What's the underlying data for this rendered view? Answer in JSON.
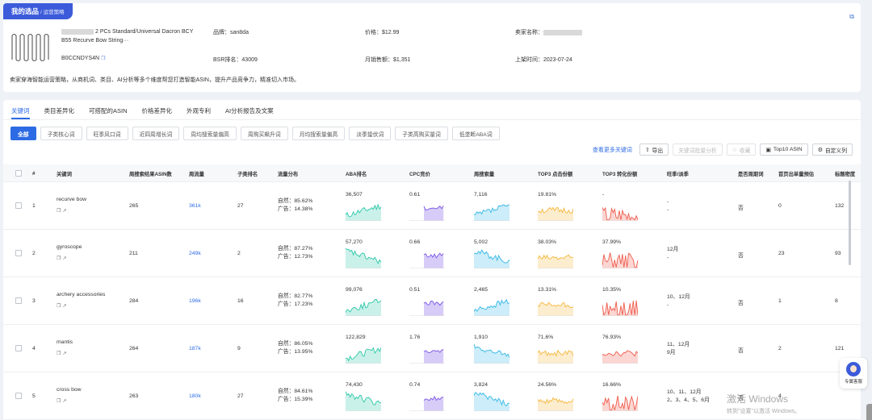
{
  "header": {
    "badge_main": "我的选品",
    "badge_sub": "/ 运营策略"
  },
  "product": {
    "name": "2 PCs Standard/Universal Dacron BCY B55 Recurve Bow String···",
    "asin": "B0CCNDYS4N",
    "brand_label": "品牌：",
    "brand": "san8da",
    "price_label": "价格：",
    "price": "$12.99",
    "seller_label": "卖家名称：",
    "bsr_label": "BSR排名：",
    "bsr": "43009",
    "sales_label": "月销售额：",
    "sales": "$1,351",
    "date_label": "上架时间：",
    "date": "2023-07-24",
    "description": "卖家穿海智能运营策略，从商机词、类目、AI分析等多个维度帮您打造智能ASIN，提升产品竞争力，精准切入市场。"
  },
  "tabs": [
    "关键词",
    "类目差异化",
    "可搭配的ASIN",
    "价格差异化",
    "外观专利",
    "AI分析报告及文案"
  ],
  "chips": [
    "全部",
    "子类核心词",
    "旺季风口词",
    "近四周增长词",
    "周均搜索量偏高",
    "周购买飙升词",
    "月均搜索量偏高",
    "淡季蛰伏词",
    "子类高购买量词",
    "低垄断ABA词"
  ],
  "toolbar": {
    "more": "查看更多关键词",
    "export": "导出",
    "batch": "关键词批量分析",
    "fav": "收藏",
    "top10": "Top10 ASIN",
    "custom": "自定义列"
  },
  "columns": [
    "#",
    "关键词",
    "周搜索结果ASIN数",
    "周流量",
    "子类排名",
    "流量分布",
    "ABA排名",
    "CPC竞价",
    "周搜索量",
    "TOP3 点击份额",
    "TOP3 转化份额",
    "旺季/淡季",
    "是否周期词",
    "首页出单量预估",
    "标题密度"
  ],
  "traffic_labels": {
    "natural": "自然：",
    "ad": "广告："
  },
  "rows": [
    {
      "num": "1",
      "keyword": "recurve bow",
      "asins": "265",
      "traffic": "361k",
      "rank": "27",
      "natural": "85.62%",
      "ad": "14.38%",
      "aba": "36,507",
      "cpc": "0.61",
      "search": "7,116",
      "click": "19.81%",
      "conv": "-",
      "season1": "-",
      "season2": "-",
      "cyclic": "否",
      "orders": "0",
      "density": "132"
    },
    {
      "num": "2",
      "keyword": "gyroscope",
      "asins": "211",
      "traffic": "249k",
      "rank": "2",
      "natural": "87.27%",
      "ad": "12.73%",
      "aba": "57,270",
      "cpc": "0.66",
      "search": "5,002",
      "click": "38.03%",
      "conv": "37.99%",
      "season1": "12月",
      "season2": "-",
      "cyclic": "否",
      "orders": "23",
      "density": "93"
    },
    {
      "num": "3",
      "keyword": "archery accessories",
      "asins": "284",
      "traffic": "196k",
      "rank": "16",
      "natural": "82.77%",
      "ad": "17.23%",
      "aba": "99,076",
      "cpc": "0.51",
      "search": "2,465",
      "click": "13.31%",
      "conv": "10.35%",
      "season1": "10、12月",
      "season2": "-",
      "cyclic": "否",
      "orders": "1",
      "density": "8"
    },
    {
      "num": "4",
      "keyword": "mantis",
      "asins": "264",
      "traffic": "187k",
      "rank": "9",
      "natural": "86.05%",
      "ad": "13.95%",
      "aba": "122,829",
      "cpc": "1.76",
      "search": "1,910",
      "click": "71.6%",
      "conv": "76.93%",
      "season1": "11、12月",
      "season2": "9月",
      "cyclic": "否",
      "orders": "2",
      "density": "121"
    },
    {
      "num": "5",
      "keyword": "cross bow",
      "asins": "263",
      "traffic": "180k",
      "rank": "27",
      "natural": "84.61%",
      "ad": "15.39%",
      "aba": "74,430",
      "cpc": "0.74",
      "search": "3,824",
      "click": "24.56%",
      "conv": "16.66%",
      "season1": "10、11、12月",
      "season2": "2、3、4、5、6月",
      "cyclic": "否",
      "orders": "4",
      "density": ""
    }
  ],
  "service": "专属客服",
  "watermark": {
    "line1": "激活 Windows",
    "line2": "转到\"设置\"以激活 Windows。"
  },
  "colors": {
    "accent": "#2d6be4",
    "aba": "#2cc7a8",
    "cpc": "#7a55e6",
    "search": "#34b7e6",
    "click": "#f5b73b",
    "conv": "#ef5b4c"
  }
}
